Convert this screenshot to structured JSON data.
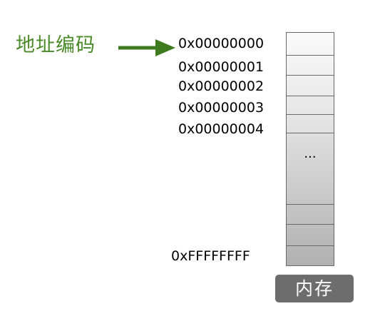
{
  "pointer": {
    "label": "地址编码",
    "label_color": "#4a8a2a",
    "arrow_color": "#3e7a1f",
    "arrow_icon": "right-arrow-icon"
  },
  "addresses": [
    "0x00000000",
    "0x00000001",
    "0x00000002",
    "0x00000003",
    "0x00000004"
  ],
  "last_address": "0xFFFFFFFF",
  "memory": {
    "ellipsis": "...",
    "label": "内存",
    "border_color": "#6a6a6a",
    "badge_color": "#6d6d6d"
  }
}
